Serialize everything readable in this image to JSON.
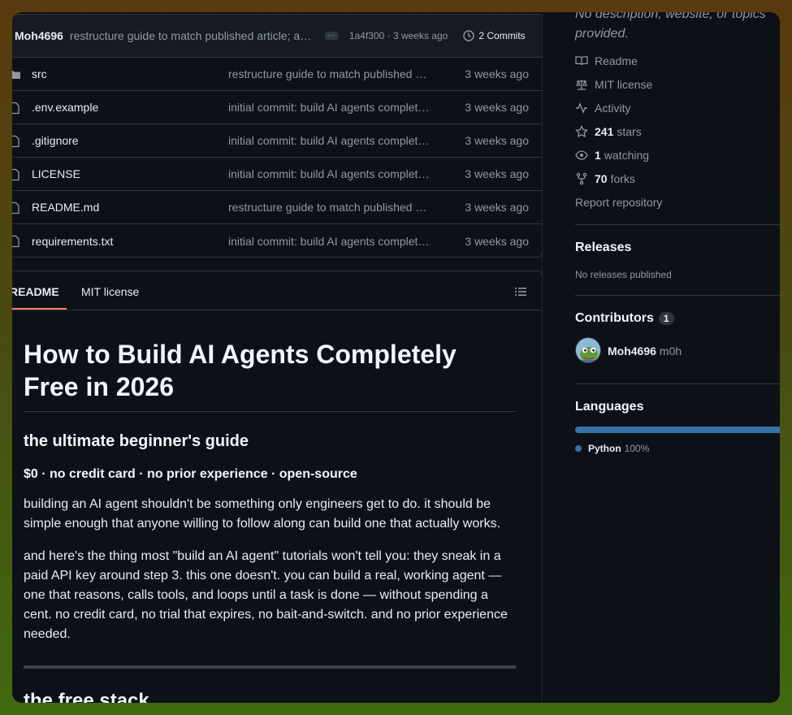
{
  "commit_bar": {
    "author": "Moh4696",
    "message": "restructure guide to match published article; al…",
    "hash_time": "1a4f300 · 3 weeks ago",
    "commits_label": "2 Commits"
  },
  "files": [
    {
      "name": "src",
      "type": "folder",
      "message": "restructure guide to match published …",
      "time": "3 weeks ago"
    },
    {
      "name": ".env.example",
      "type": "file",
      "message": "initial commit: build AI agents complet…",
      "time": "3 weeks ago"
    },
    {
      "name": ".gitignore",
      "type": "file",
      "message": "initial commit: build AI agents complet…",
      "time": "3 weeks ago"
    },
    {
      "name": "LICENSE",
      "type": "file",
      "message": "initial commit: build AI agents complet…",
      "time": "3 weeks ago"
    },
    {
      "name": "README.md",
      "type": "file",
      "message": "restructure guide to match published …",
      "time": "3 weeks ago"
    },
    {
      "name": "requirements.txt",
      "type": "file",
      "message": "initial commit: build AI agents complet…",
      "time": "3 weeks ago"
    }
  ],
  "readme": {
    "tabs": [
      "README",
      "MIT license"
    ],
    "h1": "How to Build AI Agents Completely Free in 2026",
    "h2": "the ultimate beginner's guide",
    "h3": "$0 · no credit card · no prior experience · open-source",
    "p1": "building an AI agent shouldn't be something only engineers get to do. it should be simple enough that anyone willing to follow along can build one that actually works.",
    "p2": "and here's the thing most \"build an AI agent\" tutorials won't tell you: they sneak in a paid API key around step 3. this one doesn't. you can build a real, working agent — one that reasons, calls tools, and loops until a task is done — without spending a cent. no credit card, no trial that expires, no bait-and-switch. and no prior experience needed.",
    "h2b": "the free stack"
  },
  "sidebar": {
    "description": "No description, website, or topics provided.",
    "readme_label": "Readme",
    "license_label": "MIT license",
    "activity_label": "Activity",
    "stars_count": "241",
    "stars_label": "stars",
    "watching_count": "1",
    "watching_label": "watching",
    "forks_count": "70",
    "forks_label": "forks",
    "report_label": "Report repository",
    "releases_title": "Releases",
    "releases_empty": "No releases published",
    "contributors_title": "Contributors",
    "contributors_count": "1",
    "contributor_user": "Moh4696",
    "contributor_name": "m0h",
    "languages_title": "Languages",
    "language_name": "Python",
    "language_pct": "100%",
    "language_color": "#3572a5"
  }
}
